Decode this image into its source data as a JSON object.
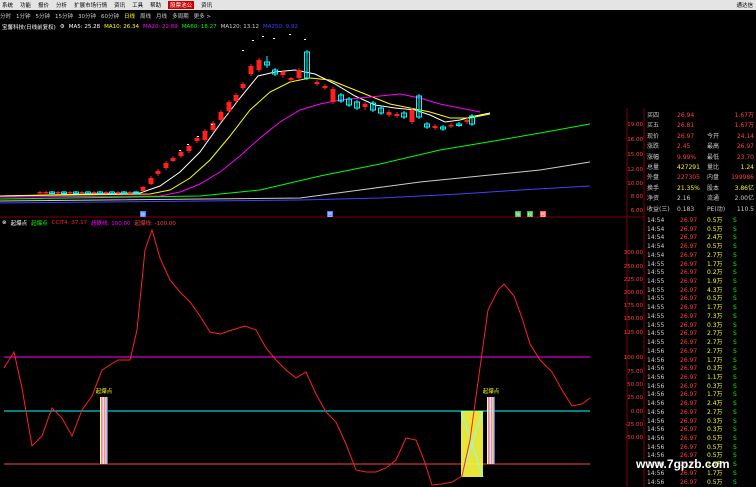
{
  "menubar": {
    "items": [
      "系统",
      "功能",
      "报价",
      "分析",
      "扩展市场行情",
      "资讯",
      "工具",
      "帮助",
      "股票池公",
      "资讯"
    ],
    "active_index": 8,
    "window_title": "通达信"
  },
  "periods": {
    "items": [
      "分时",
      "1分钟",
      "5分钟",
      "15分钟",
      "30分钟",
      "60分钟",
      "日线",
      "周线",
      "月线",
      "多周期",
      "更多 >"
    ],
    "selected_index": 6
  },
  "ma_legend": {
    "stock": "宝馨科技(日线前复权)",
    "items": [
      {
        "text": "MA5: 25.28",
        "color": "#ffffff"
      },
      {
        "text": "MA10: 26.34",
        "color": "#ffff00"
      },
      {
        "text": "MA20: 22.89",
        "color": "#ff00ff"
      },
      {
        "text": "MA60: 18.27",
        "color": "#00ff00"
      },
      {
        "text": "MA120: 13.12",
        "color": "#cccccc"
      },
      {
        "text": "MA250: 9.92",
        "color": "#4040ff"
      }
    ]
  },
  "price_axis": {
    "labels": [
      "19.00",
      "16.00",
      "15.00",
      "12.00",
      "10.00",
      "8.00",
      "6.00"
    ]
  },
  "candle_markers": [
    "除",
    "回",
    "除",
    "权",
    "回"
  ],
  "indicator": {
    "name": "起爆点",
    "legend": [
      {
        "text": "起爆点",
        "color": "#00ff00"
      },
      {
        "text": "CCIT4: 37.17",
        "color": "#ff2020"
      },
      {
        "text": "超跌线: 100.00",
        "color": "#ff00ff"
      },
      {
        "text": "起爆线: -100.00",
        "color": "#ff4040"
      }
    ],
    "axis_labels": [
      "300.00",
      "250.00",
      "225.00",
      "200.00",
      "175.00",
      "150.00",
      "125.00",
      "100.00",
      "75.00",
      "50.00",
      "25.00",
      "0.00",
      "-25.00",
      "-50.00"
    ],
    "signal_label": "起爆点"
  },
  "quote": {
    "rows": [
      {
        "left_label": "买四",
        "left_value": "26.94",
        "right_label": "",
        "right_value": "1.67万",
        "value_color": "#ff4040"
      },
      {
        "left_label": "买五",
        "left_value": "26.81",
        "right_label": "",
        "right_value": "1.67万",
        "value_color": "#ff4040"
      },
      {
        "left_label": "现价",
        "left_value": "26.97",
        "right_label": "今开",
        "right_value": "24.14",
        "value_color": "#ff4040"
      },
      {
        "left_label": "涨跌",
        "left_value": "2.45",
        "right_label": "最高",
        "right_value": "26.97",
        "value_color": "#ff4040"
      },
      {
        "left_label": "涨幅",
        "left_value": "9.99%",
        "right_label": "最低",
        "right_value": "23.70",
        "value_color": "#ff4040"
      },
      {
        "left_label": "总量",
        "left_value": "427291",
        "right_label": "量比",
        "right_value": "1.24",
        "value_color": "#ffff00"
      },
      {
        "left_label": "外盘",
        "left_value": "227305",
        "right_label": "内盘",
        "right_value": "199986",
        "value_color": "#ff4040"
      },
      {
        "left_label": "换手",
        "left_value": "21.35%",
        "right_label": "股本",
        "right_value": "3.86亿",
        "value_color": "#ffff00"
      },
      {
        "left_label": "净资",
        "left_value": "2.16",
        "right_label": "流通",
        "right_value": "2.00亿",
        "value_color": "#cccccc"
      },
      {
        "left_label": "收益(三)",
        "left_value": "0.183",
        "right_label": "PE(动)",
        "right_value": "110.5",
        "value_color": "#cccccc"
      }
    ]
  },
  "ticks": [
    {
      "time": "14:54",
      "price": "26.97",
      "vol": "0.5万",
      "dir": "S"
    },
    {
      "time": "14:54",
      "price": "26.97",
      "vol": "0.5万",
      "dir": "S"
    },
    {
      "time": "14:54",
      "price": "26.97",
      "vol": "2.4万",
      "dir": "S"
    },
    {
      "time": "14:54",
      "price": "26.97",
      "vol": "0.5万",
      "dir": "S"
    },
    {
      "time": "14:54",
      "price": "26.97",
      "vol": "2.7万",
      "dir": "S"
    },
    {
      "time": "14:55",
      "price": "26.97",
      "vol": "1.7万",
      "dir": "S"
    },
    {
      "time": "14:55",
      "price": "26.97",
      "vol": "0.2万",
      "dir": "S"
    },
    {
      "time": "14:55",
      "price": "26.97",
      "vol": "1.9万",
      "dir": "S"
    },
    {
      "time": "14:55",
      "price": "26.97",
      "vol": "4.3万",
      "dir": "S"
    },
    {
      "time": "14:55",
      "price": "26.97",
      "vol": "0.5万",
      "dir": "S"
    },
    {
      "time": "14:55",
      "price": "26.97",
      "vol": "1.7万",
      "dir": "S"
    },
    {
      "time": "14:55",
      "price": "26.97",
      "vol": "7.3万",
      "dir": "S"
    },
    {
      "time": "14:55",
      "price": "26.97",
      "vol": "0.3万",
      "dir": "S"
    },
    {
      "time": "14:55",
      "price": "26.97",
      "vol": "2.7万",
      "dir": "S"
    },
    {
      "time": "14:55",
      "price": "26.97",
      "vol": "2.7万",
      "dir": "S"
    },
    {
      "time": "14:56",
      "price": "26.97",
      "vol": "2.7万",
      "dir": "S"
    },
    {
      "time": "14:56",
      "price": "26.97",
      "vol": "1.7万",
      "dir": "S"
    },
    {
      "time": "14:56",
      "price": "26.97",
      "vol": "0.3万",
      "dir": "S"
    },
    {
      "time": "14:56",
      "price": "26.97",
      "vol": "1.1万",
      "dir": "S"
    },
    {
      "time": "14:56",
      "price": "26.97",
      "vol": "0.3万",
      "dir": "S"
    },
    {
      "time": "14:56",
      "price": "26.97",
      "vol": "1.7万",
      "dir": "S"
    },
    {
      "time": "14:56",
      "price": "26.97",
      "vol": "2.4万",
      "dir": "S"
    },
    {
      "time": "14:56",
      "price": "26.97",
      "vol": "2.7万",
      "dir": "S"
    },
    {
      "time": "14:56",
      "price": "26.97",
      "vol": "0.3万",
      "dir": "S"
    },
    {
      "time": "14:56",
      "price": "26.97",
      "vol": "0.3万",
      "dir": "S"
    },
    {
      "time": "14:56",
      "price": "26.97",
      "vol": "0.5万",
      "dir": "S"
    },
    {
      "time": "14:56",
      "price": "26.97",
      "vol": "0.5万",
      "dir": "S"
    },
    {
      "time": "14:56",
      "price": "26.97",
      "vol": "0.5万",
      "dir": "S"
    },
    {
      "time": "14:56",
      "price": "26.97",
      "vol": "1.5万",
      "dir": "S"
    },
    {
      "time": "14:56",
      "price": "26.97",
      "vol": "1.7万",
      "dir": "S"
    },
    {
      "time": "14:56",
      "price": "26.97",
      "vol": "0.5万",
      "dir": "S"
    }
  ],
  "watermark": "www.7gpzb.com",
  "colors": {
    "up": "#ff2020",
    "down": "#00ffff",
    "ma5": "#ffffff",
    "ma10": "#ffff00",
    "ma20": "#ff00ff",
    "ma60": "#00ff00",
    "ma120": "#cccccc",
    "ma250": "#4040ff",
    "cci_line": "#ff2020",
    "upper_line": "#ff00ff",
    "zero_line": "#00ffff",
    "lower_line": "#ff4040",
    "signal_fill": "#ffff40"
  }
}
